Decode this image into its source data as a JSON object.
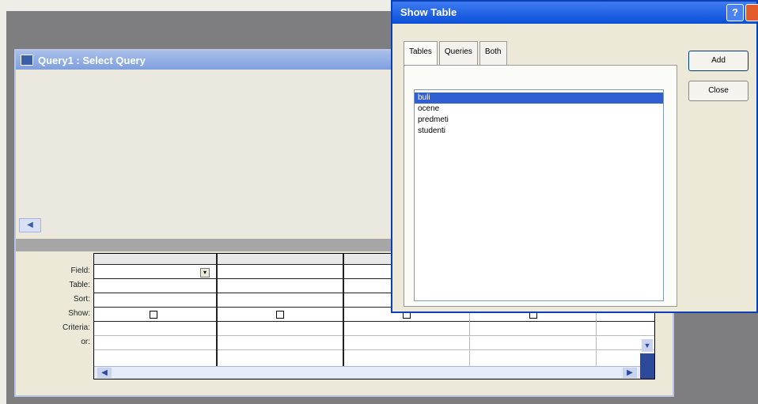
{
  "query_window": {
    "title": "Query1 : Select Query"
  },
  "design_grid": {
    "row_labels": [
      "Field:",
      "Table:",
      "Sort:",
      "Show:",
      "Criteria:",
      "or:"
    ]
  },
  "show_table_dialog": {
    "title": "Show Table",
    "help_button": "?",
    "tabs": [
      "Tables",
      "Queries",
      "Both"
    ],
    "active_tab": "Tables",
    "tables": [
      "buli",
      "ocene",
      "predmeti",
      "studenti"
    ],
    "selected_table": "buli",
    "add_button": "Add",
    "close_button": "Close"
  }
}
